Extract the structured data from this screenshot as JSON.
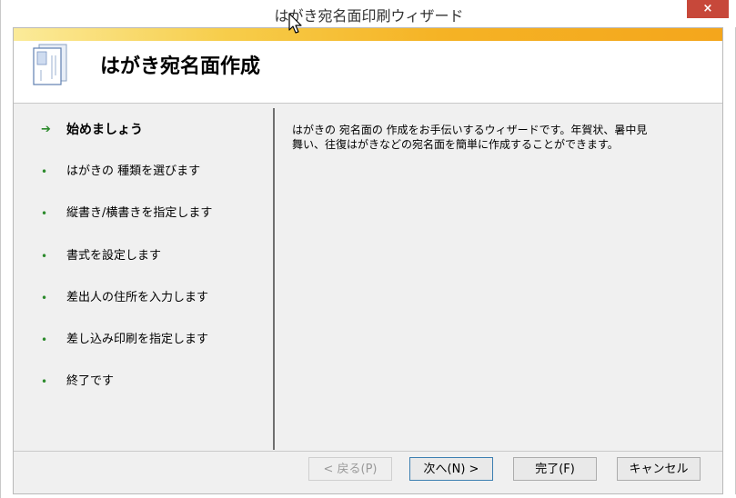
{
  "window": {
    "title": "はがき宛名面印刷ウィザード",
    "close_label": "×"
  },
  "header": {
    "title": "はがき宛名面作成",
    "icon": "postcard-icon",
    "accent_color": "#f4a61c"
  },
  "steps": [
    {
      "label": "始めましょう",
      "current": true
    },
    {
      "label": "はがきの 種類を選びます",
      "current": false
    },
    {
      "label": "縦書き/横書きを指定します",
      "current": false
    },
    {
      "label": "書式を設定します",
      "current": false
    },
    {
      "label": "差出人の住所を入力します",
      "current": false
    },
    {
      "label": "差し込み印刷を指定します",
      "current": false
    },
    {
      "label": "終了です",
      "current": false
    }
  ],
  "content": {
    "description_line1": "はがきの 宛名面の 作成をお手伝いするウィザードです。年賀状、暑中見",
    "description_line2": "舞い、往復はがきなどの宛名面を簡単に作成することができます。"
  },
  "buttons": {
    "back": "< 戻る(P)",
    "next": "次へ(N) >",
    "finish": "完了(F)",
    "cancel": "キャンセル"
  },
  "icons": {
    "current_step": "arrow-right-icon",
    "other_step": "bullet-icon",
    "close": "close-icon",
    "cursor": "mouse-pointer-icon"
  }
}
